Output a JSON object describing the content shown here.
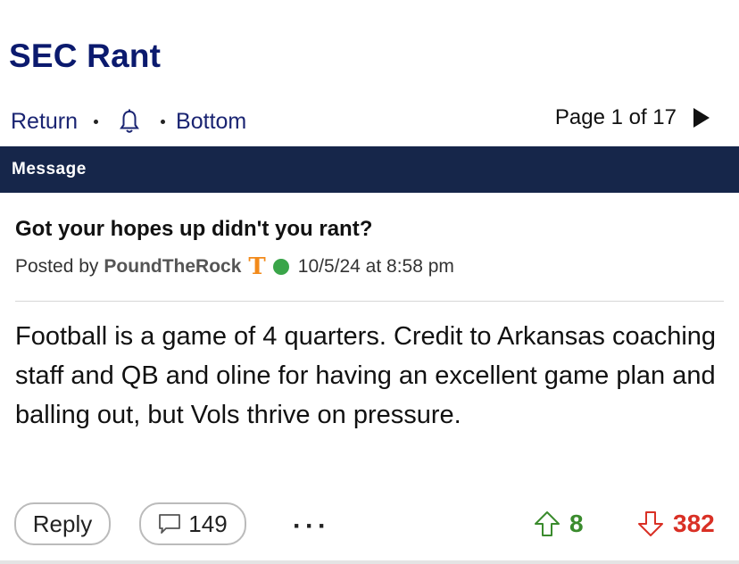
{
  "forum": {
    "title": "SEC Rant"
  },
  "nav": {
    "return_label": "Return",
    "bottom_label": "Bottom",
    "page_label": "Page 1 of 17",
    "bell_icon": "bell-icon",
    "next_icon": "next-page-arrow-icon"
  },
  "header": {
    "label": "Message"
  },
  "post": {
    "subject": "Got your hopes up didn't you rant?",
    "posted_by_prefix": "Posted by",
    "author": "PoundTheRock",
    "team_logo_text": "T",
    "team_logo_color": "#f28a1a",
    "online_status_color": "#3aa549",
    "timestamp": "10/5/24 at 8:58 pm",
    "body": "Football is a game of 4 quarters. Credit to Arkansas coaching staff and QB and oline for having an excellent game plan and balling out, but Vols thrive on pressure."
  },
  "actions": {
    "reply_label": "Reply",
    "reply_count": "149",
    "more_label": "···",
    "upvotes": "8",
    "downvotes": "382",
    "upvote_color": "#3a8b2d",
    "downvote_color": "#d93025"
  },
  "colors": {
    "brand_navy": "#0b1a6e",
    "header_bar": "#16264a"
  }
}
